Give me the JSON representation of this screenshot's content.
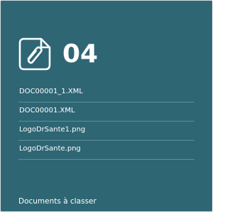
{
  "tile": {
    "icon": "paperclip-document-icon",
    "count": "04",
    "documents": [
      {
        "name": "DOC00001_1.XML"
      },
      {
        "name": "DOC00001.XML"
      },
      {
        "name": "LogoDrSante1.png"
      },
      {
        "name": "LogoDrSante.png"
      }
    ],
    "footer_label": "Documents à classer"
  },
  "colors": {
    "background": "#2e6674",
    "text": "#ffffff",
    "divider": "#5f8f9b"
  }
}
